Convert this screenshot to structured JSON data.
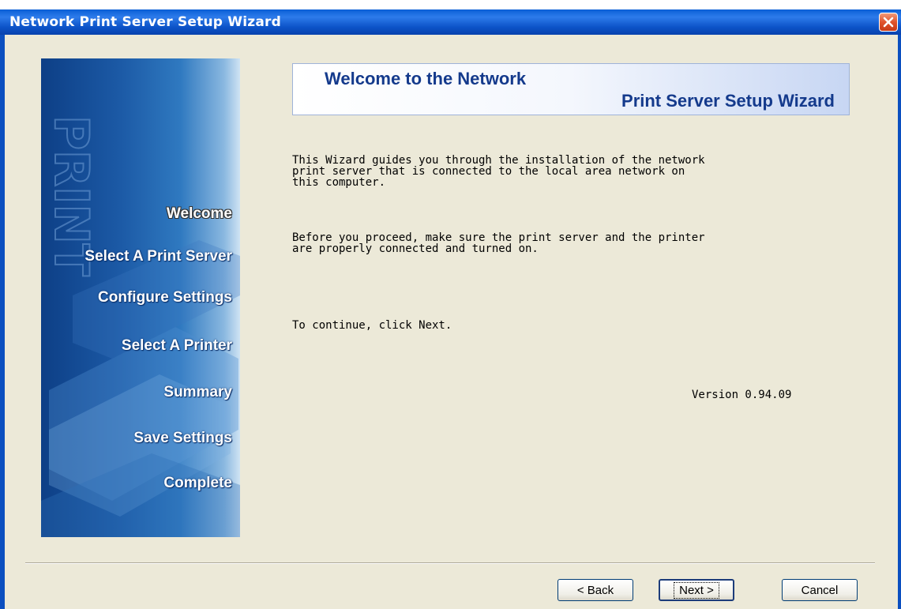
{
  "window": {
    "title": "Network Print Server Setup Wizard"
  },
  "sidebar": {
    "watermark": "PRINT",
    "steps": [
      {
        "label": "Welcome",
        "active": true
      },
      {
        "label": "Select A Print Server",
        "active": false
      },
      {
        "label": "Configure Settings",
        "active": false
      },
      {
        "label": "Select  A  Printer",
        "active": false
      },
      {
        "label": "Summary",
        "active": false
      },
      {
        "label": "Save Settings",
        "active": false
      },
      {
        "label": "Complete",
        "active": false
      }
    ]
  },
  "banner": {
    "line1": "Welcome to the Network",
    "line2": "Print Server Setup Wizard"
  },
  "content": {
    "para1": "This Wizard guides you through the installation of the network\nprint server that is connected to the local area network on\nthis computer.",
    "para2": "Before you proceed, make sure the print server and the printer\nare properly connected and turned on.",
    "para3": "To continue, click Next.",
    "version": "Version 0.94.09"
  },
  "buttons": {
    "back": "< Back",
    "next": "Next >",
    "cancel": "Cancel"
  },
  "colors": {
    "titlebar": "#0c53c8",
    "sidepanel": "#1c5aa6",
    "banner_text": "#143a8c",
    "window_bg": "#ece9d8"
  }
}
